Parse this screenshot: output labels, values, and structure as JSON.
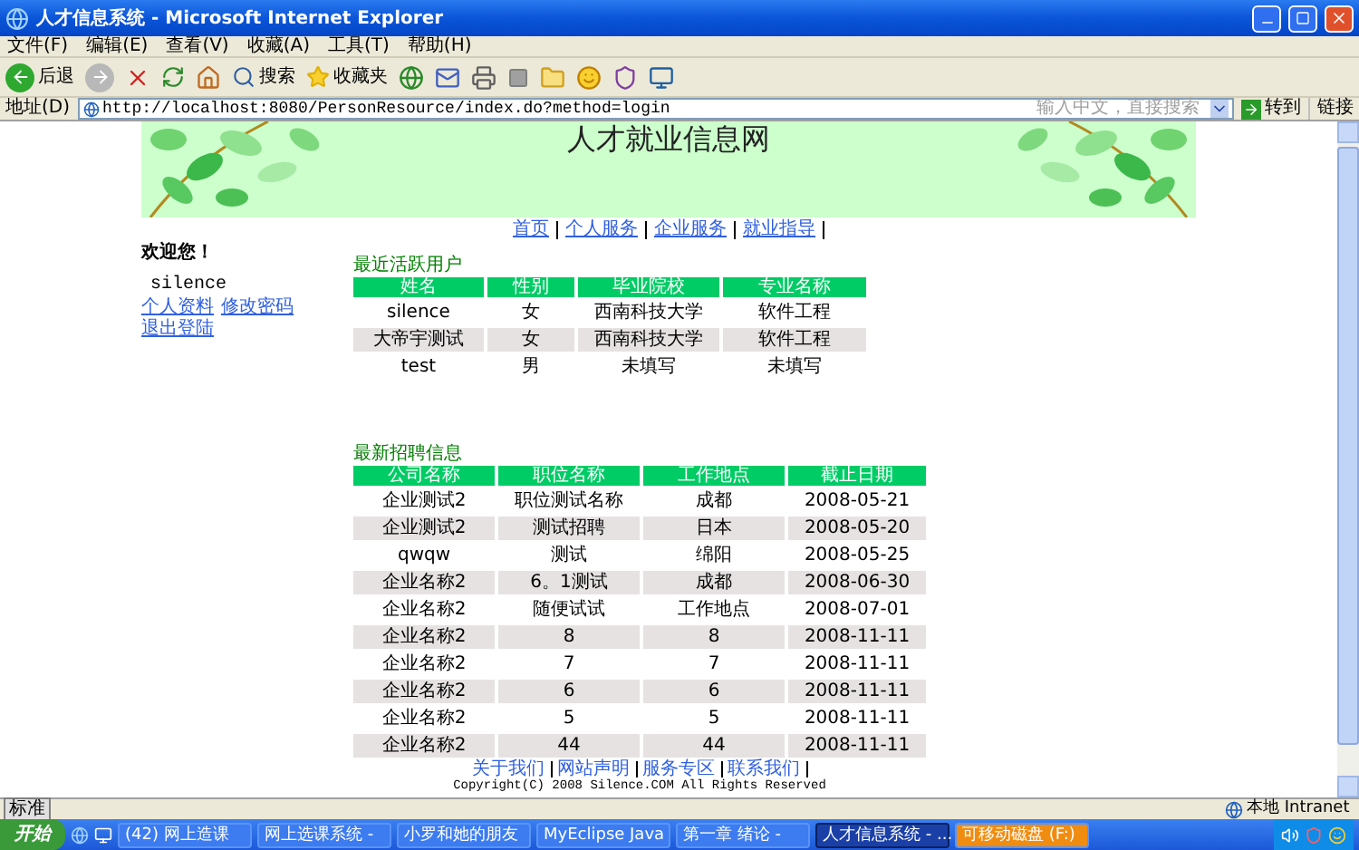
{
  "window": {
    "title": "人才信息系统 - Microsoft Internet Explorer"
  },
  "menu": [
    "文件(F)",
    "编辑(E)",
    "查看(V)",
    "收藏(A)",
    "工具(T)",
    "帮助(H)"
  ],
  "toolbar": {
    "back": "后退",
    "search": "搜索",
    "favorites": "收藏夹"
  },
  "address_bar": {
    "label": "地址(D)",
    "url": "http://localhost:8080/PersonResource/index.do?method=login",
    "search_placeholder": "输入中文，直接搜索",
    "go": "转到",
    "links": "链接"
  },
  "page": {
    "site_title": "人才就业信息网",
    "nav": [
      "首页",
      "个人服务",
      "企业服务",
      "就业指导"
    ],
    "welcome": "欢迎您！",
    "username": "silence",
    "user_links": [
      "个人资料",
      "修改密码",
      "退出登陆"
    ],
    "active_users": {
      "title": "最近活跃用户",
      "columns": [
        "姓名",
        "性别",
        "毕业院校",
        "专业名称"
      ],
      "rows": [
        [
          "silence",
          "女",
          "西南科技大学",
          "软件工程"
        ],
        [
          "大帝宇测试",
          "女",
          "西南科技大学",
          "软件工程"
        ],
        [
          "test",
          "男",
          "未填写",
          "未填写"
        ]
      ]
    },
    "jobs": {
      "title": "最新招聘信息",
      "columns": [
        "公司名称",
        "职位名称",
        "工作地点",
        "截止日期"
      ],
      "rows": [
        [
          "企业测试2",
          "职位测试名称",
          "成都",
          "2008-05-21"
        ],
        [
          "企业测试2",
          "测试招聘",
          "日本",
          "2008-05-20"
        ],
        [
          "qwqw",
          "测试",
          "绵阳",
          "2008-05-25"
        ],
        [
          "企业名称2",
          "6。1测试",
          "成都",
          "2008-06-30"
        ],
        [
          "企业名称2",
          "随便试试",
          "工作地点",
          "2008-07-01"
        ],
        [
          "企业名称2",
          "8",
          "8",
          "2008-11-11"
        ],
        [
          "企业名称2",
          "7",
          "7",
          "2008-11-11"
        ],
        [
          "企业名称2",
          "6",
          "6",
          "2008-11-11"
        ],
        [
          "企业名称2",
          "5",
          "5",
          "2008-11-11"
        ],
        [
          "企业名称2",
          "44",
          "44",
          "2008-11-11"
        ]
      ]
    },
    "footer_links": [
      "关于我们",
      "网站声明",
      "服务专区",
      "联系我们"
    ],
    "copyright": "Copyright(C) 2008 Silence.COM All Rights Reserved"
  },
  "status_bar": {
    "ime": "标准",
    "zone": "本地 Intranet"
  },
  "taskbar": {
    "start": "开始",
    "tasks": [
      {
        "label": "(42) 网上造课",
        "selected": false,
        "flashing": false
      },
      {
        "label": "网上选课系统 -",
        "selected": false,
        "flashing": false
      },
      {
        "label": "小罗和她的朋友",
        "selected": false,
        "flashing": false
      },
      {
        "label": "MyEclipse Java",
        "selected": false,
        "flashing": false
      },
      {
        "label": "第一章 绪论 -",
        "selected": false,
        "flashing": false
      },
      {
        "label": "人才信息系统 - ...",
        "selected": true,
        "flashing": false
      },
      {
        "label": "可移动磁盘 (F:)",
        "selected": false,
        "flashing": true
      }
    ]
  }
}
